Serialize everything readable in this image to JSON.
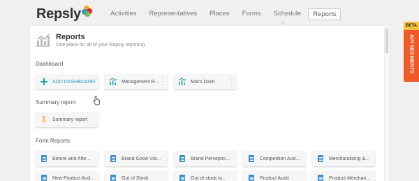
{
  "app": {
    "logo_text": "Repsly",
    "logo_colors": [
      "#f6a81c",
      "#e2232a",
      "#2b9bd6",
      "#7ab648"
    ]
  },
  "nav": {
    "items": [
      {
        "label": "Activities",
        "active": false
      },
      {
        "label": "Representatives",
        "active": false
      },
      {
        "label": "Places",
        "active": false
      },
      {
        "label": "Forms",
        "active": false
      },
      {
        "label": "Schedule",
        "active": false
      },
      {
        "label": "Reports",
        "active": true
      }
    ]
  },
  "page": {
    "title": "Reports",
    "subtitle": "One place for all of your Repsly reporting",
    "icon": "bar-chart-icon"
  },
  "sections": {
    "dashboard": {
      "label": "Dashboard",
      "add_label": "ADD DASHBOARD",
      "cards": [
        {
          "label": "Management Repo...",
          "icon": "dashboard-chart-icon"
        },
        {
          "label": "Mat's Dash",
          "icon": "dashboard-chart-icon"
        }
      ]
    },
    "summary": {
      "label": "Summary report",
      "cards": [
        {
          "label": "Summary report",
          "icon": "sigma-icon"
        }
      ]
    },
    "forms": {
      "label": "Form Reports",
      "cards": [
        {
          "label": "Before and Afte...",
          "icon": "document-icon"
        },
        {
          "label": "Brand Good Visi...",
          "icon": "document-icon"
        },
        {
          "label": "Brand Perceptio...",
          "icon": "document-icon"
        },
        {
          "label": "Competition Aud...",
          "icon": "document-icon"
        },
        {
          "label": "Merchandising &...",
          "icon": "document-icon"
        },
        {
          "label": "New Product Aud...",
          "icon": "document-icon"
        },
        {
          "label": "Out of Stock",
          "icon": "document-icon"
        },
        {
          "label": "Out of stock to...",
          "icon": "document-icon"
        },
        {
          "label": "Product Audit",
          "icon": "document-icon"
        },
        {
          "label": "Product Merchan...",
          "icon": "document-icon"
        }
      ]
    }
  },
  "side_tab": {
    "badge": "BETA",
    "label": "API SEGMENTS",
    "color": "#f05a28",
    "badge_color": "#f6c33e"
  }
}
